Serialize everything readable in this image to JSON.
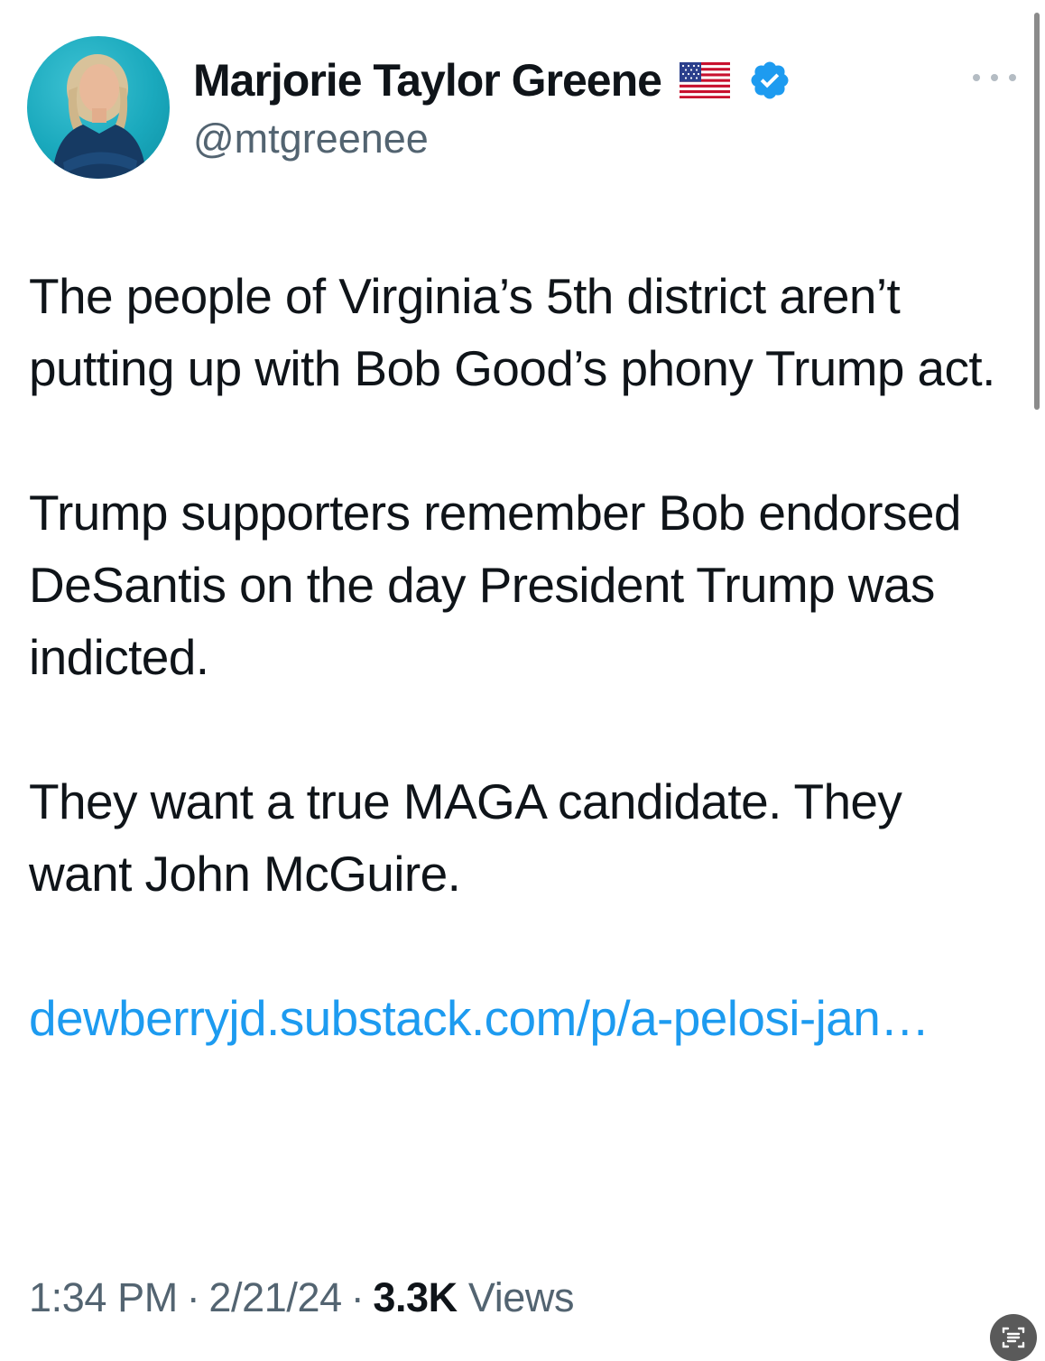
{
  "author": {
    "display_name": "Marjorie Taylor Greene",
    "handle": "@mtgreenee",
    "flag_icon": "us-flag-icon",
    "verified_icon": "verified-badge-icon",
    "verified_color": "#1d9bf0"
  },
  "tweet": {
    "paragraphs": [
      "The people of Virginia’s 5th district aren’t putting up with Bob Good’s phony Trump act.",
      "Trump supporters remember Bob endorsed DeSantis on the day President Trump was indicted.",
      "They want a true MAGA candidate. They want John McGuire."
    ],
    "link_text": "dewberryjd.substack.com/p/a-pelosi-jan…"
  },
  "meta": {
    "time": "1:34 PM",
    "separator": "·",
    "date": "2/21/24",
    "views_count": "3.3K",
    "views_label": "Views"
  },
  "colors": {
    "link": "#1d9bf0",
    "text": "#0f1419",
    "muted": "#536471"
  }
}
